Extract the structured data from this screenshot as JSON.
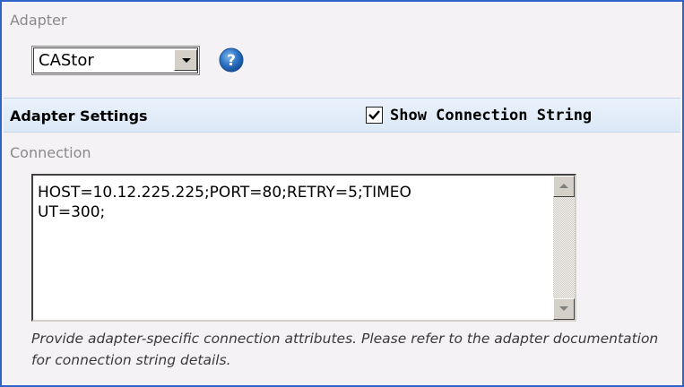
{
  "adapter": {
    "label": "Adapter",
    "selected": "CAStor",
    "help_icon": "question-mark-icon"
  },
  "settings": {
    "title": "Adapter Settings",
    "show_connection_string": {
      "label": "Show Connection String",
      "checked": true
    }
  },
  "connection": {
    "label": "Connection",
    "value": "HOST=10.12.225.225;PORT=80;RETRY=5;TIMEO\nUT=300;",
    "hint": "Provide adapter-specific connection attributes. Please refer to the adapter documentation for connection string details."
  },
  "colors": {
    "frame_border": "#2e64c8",
    "panel_background": "#f5f2f5",
    "settings_bar": "#dce8f6",
    "help_icon": "#2a72c4"
  }
}
